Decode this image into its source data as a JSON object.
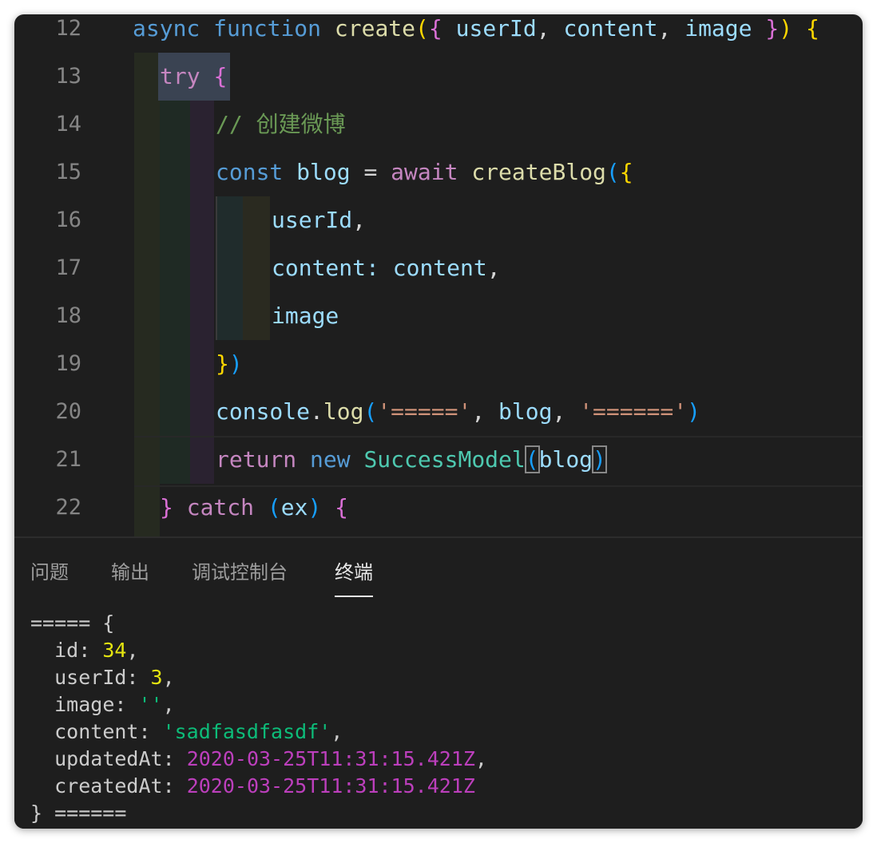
{
  "editor": {
    "lines": [
      {
        "num": "12",
        "tokens": [
          "async",
          "function",
          "create",
          "(",
          "{",
          "userId",
          ",",
          "content",
          ",",
          "image",
          "}",
          ")",
          "{"
        ]
      },
      {
        "num": "13",
        "tokens": [
          "try",
          "{"
        ]
      },
      {
        "num": "14",
        "tokens": [
          "// 创建微博"
        ]
      },
      {
        "num": "15",
        "tokens": [
          "const",
          "blog",
          "=",
          "await",
          "createBlog",
          "(",
          "{"
        ]
      },
      {
        "num": "16",
        "tokens": [
          "userId",
          ","
        ]
      },
      {
        "num": "17",
        "tokens": [
          "content",
          ":",
          "content",
          ","
        ]
      },
      {
        "num": "18",
        "tokens": [
          "image"
        ]
      },
      {
        "num": "19",
        "tokens": [
          "}",
          ")"
        ]
      },
      {
        "num": "20",
        "tokens": [
          "console",
          ".",
          "log",
          "(",
          "'====='",
          ",",
          "blog",
          ",",
          "'======'",
          ")"
        ]
      },
      {
        "num": "21",
        "tokens": [
          "return",
          "new",
          "SuccessModel",
          "(",
          "blog",
          ")"
        ]
      },
      {
        "num": "22",
        "tokens": [
          "}",
          "catch",
          "(",
          "ex",
          ")",
          "{"
        ]
      }
    ]
  },
  "panel": {
    "tabs": [
      "问题",
      "输出",
      "调试控制台",
      "终端"
    ],
    "active_tab": "终端",
    "terminal": {
      "open": "===== {",
      "fields": [
        {
          "key": "id",
          "sep": ": ",
          "value": "34",
          "type": "num",
          "trail": ","
        },
        {
          "key": "userId",
          "sep": ": ",
          "value": "3",
          "type": "num",
          "trail": ","
        },
        {
          "key": "image",
          "sep": ": ",
          "value": "''",
          "type": "str",
          "trail": ","
        },
        {
          "key": "content",
          "sep": ": ",
          "value": "'sadfasdfasdf'",
          "type": "str",
          "trail": ","
        },
        {
          "key": "updatedAt",
          "sep": ": ",
          "value": "2020-03-25T11:31:15.421Z",
          "type": "date",
          "trail": ","
        },
        {
          "key": "createdAt",
          "sep": ": ",
          "value": "2020-03-25T11:31:15.421Z",
          "type": "date",
          "trail": ""
        }
      ],
      "close": "} ======"
    }
  },
  "colors": {
    "background": "#1e1e1e",
    "keyword": "#569cd6",
    "control": "#c586c0",
    "function": "#dcdcaa",
    "variable": "#9cdcfe",
    "class": "#4ec9b0",
    "string": "#ce9178",
    "comment": "#6a9955",
    "term_number": "#e5e510",
    "term_string": "#0dbc79",
    "term_date": "#bc3fbc"
  }
}
